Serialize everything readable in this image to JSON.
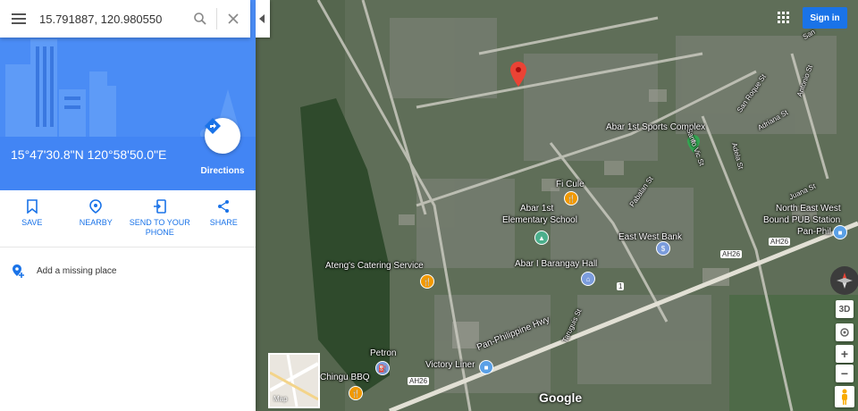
{
  "search": {
    "query": "15.791887, 120.980550"
  },
  "place": {
    "coordinates": "15°47'30.8\"N 120°58'50.0\"E",
    "directions_label": "Directions"
  },
  "actions": [
    {
      "label": "SAVE",
      "icon": "bookmark-icon"
    },
    {
      "label": "NEARBY",
      "icon": "location-pin-icon"
    },
    {
      "label": "SEND TO YOUR PHONE",
      "icon": "phone-send-icon"
    },
    {
      "label": "SHARE",
      "icon": "share-icon"
    }
  ],
  "missing_place": {
    "label": "Add a missing place",
    "icon": "add-place-icon"
  },
  "map": {
    "labels": {
      "sports_complex": "Abar 1st Sports Complex",
      "fi_cule": "Fi Cule",
      "elementary_1": "Abar 1st",
      "elementary_2": "Elementary School",
      "bank": "East West Bank",
      "station_1": "North East West",
      "station_2": "Bound PUB Station",
      "pan_phil": "Pan-Phil",
      "catering": "Ateng's Catering Service",
      "barangay": "Abar I Barangay Hall",
      "highway": "Pan-Philippine Hwy",
      "petron": "Petron",
      "chingu": "Chingu BBQ",
      "victory": "Victory Liner",
      "ah26_a": "AH26",
      "ah26_b": "AH26",
      "ah26_c": "AH26",
      "road_1": "1",
      "st_sanroque": "San Roque St",
      "st_antonio": "Antonio St",
      "st_adriana": "Adriana St",
      "st_juana": "Juana St",
      "st_adela": "Adela St",
      "st_santovic": "Santo Vic St",
      "st_pabalan": "Pabalan St",
      "st_taruguis": "Taruguis St",
      "st_san": "San"
    },
    "colors": {
      "marker": "#ea4335",
      "green_pin": "#34a853",
      "food_poi": "#f29900",
      "civic_poi": "#7b9cdc"
    }
  },
  "controls": {
    "sign_in": "Sign in",
    "three_d": "3D",
    "zoom_in": "+",
    "zoom_out": "−",
    "map_toggle": "Map",
    "brand": "Google"
  },
  "colors": {
    "accent": "#1a73e8",
    "hero_bg": "#4285f4"
  }
}
